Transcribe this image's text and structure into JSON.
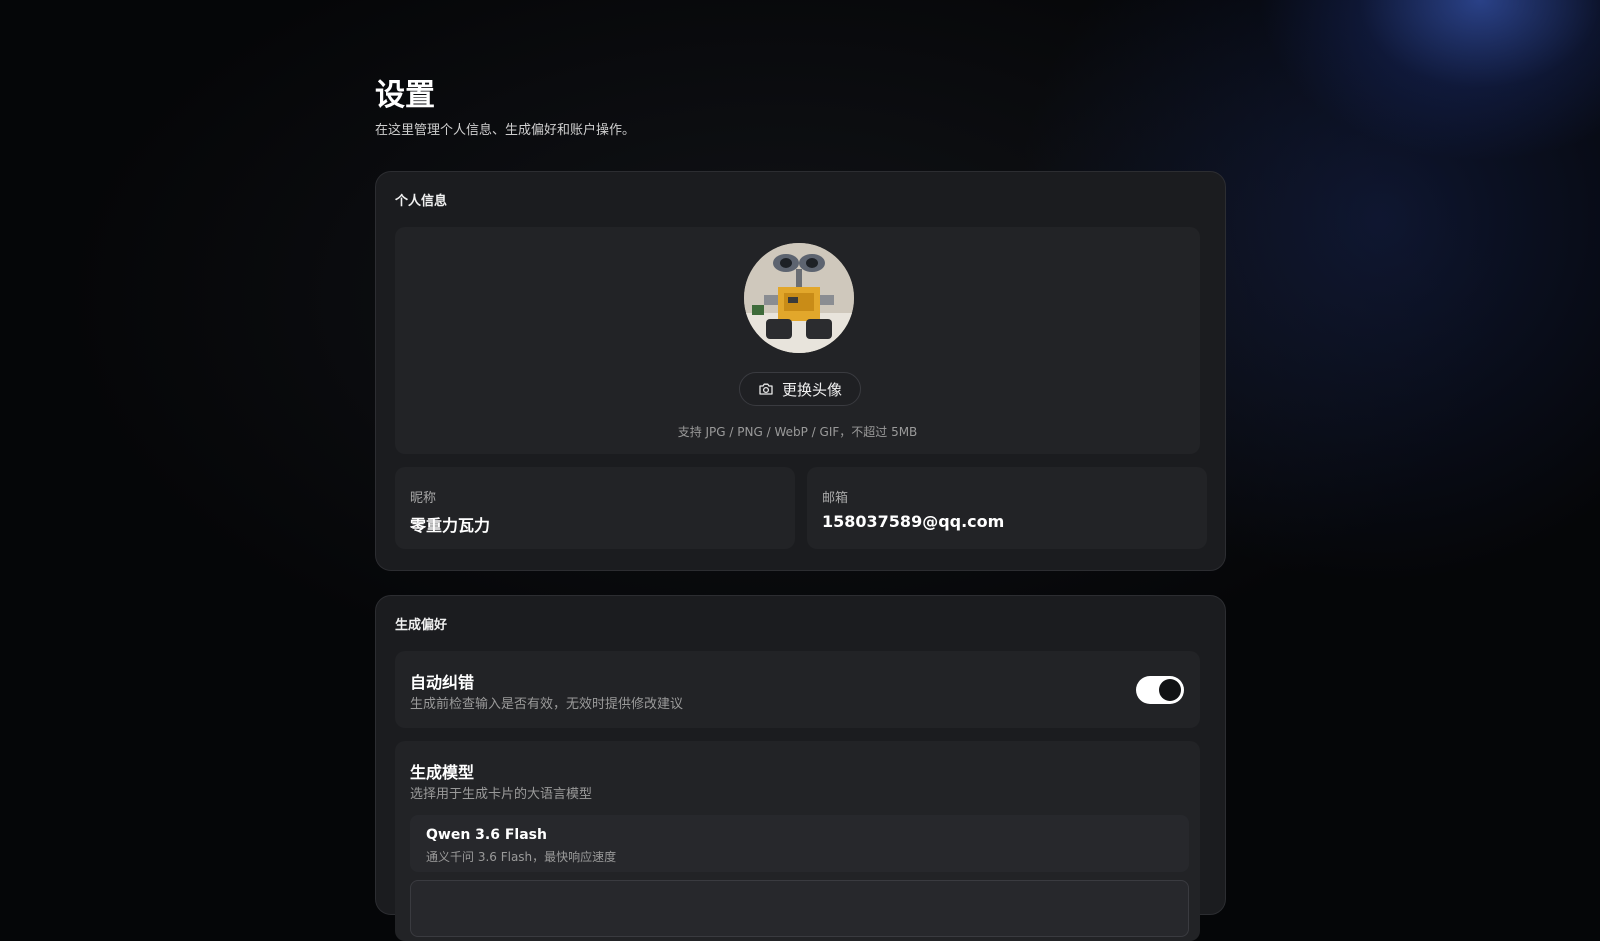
{
  "page": {
    "title": "设置",
    "subtitle": "在这里管理个人信息、生成偏好和账户操作。"
  },
  "profile": {
    "section_title": "个人信息",
    "change_avatar_label": "更换头像",
    "avatar_hint": "支持 JPG / PNG / WebP / GIF，不超过 5MB",
    "nickname_label": "昵称",
    "nickname_value": "零重力瓦力",
    "email_label": "邮箱",
    "email_value": "158037589@qq.com"
  },
  "preferences": {
    "section_title": "生成偏好",
    "auto_correct": {
      "title": "自动纠错",
      "description": "生成前检查输入是否有效，无效时提供修改建议",
      "enabled": true
    },
    "model": {
      "title": "生成模型",
      "description": "选择用于生成卡片的大语言模型",
      "options": [
        {
          "name": "Qwen 3.6 Flash",
          "description": "通义千问 3.6 Flash，最快响应速度"
        },
        {
          "name": "",
          "description": ""
        }
      ]
    }
  },
  "colors": {
    "background": "#050608",
    "card": "#1b1c1f",
    "panel": "#222326",
    "accent_glow": "#466ee6",
    "toggle_on": "#ffffff"
  },
  "icons": {
    "change_avatar": "camera-icon"
  }
}
